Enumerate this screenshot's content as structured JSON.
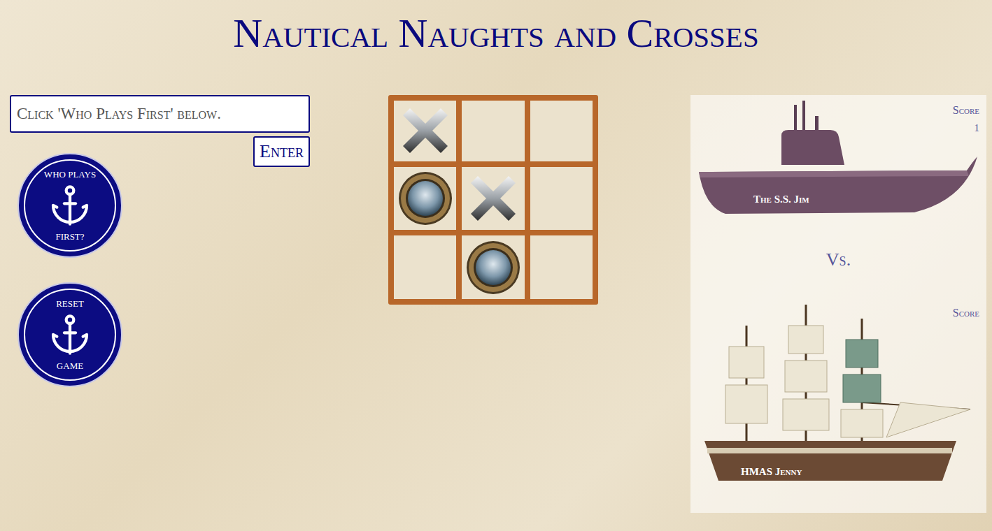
{
  "title": "Nautical Naughts and Crosses",
  "prompt": {
    "text": "Click 'Who Plays First' below."
  },
  "enter_button": "Enter",
  "round_buttons": [
    {
      "top": "WHO PLAYS",
      "bottom": "FIRST?"
    },
    {
      "top": "RESET",
      "bottom": "GAME"
    }
  ],
  "board": {
    "cells": [
      {
        "mark": "cross"
      },
      {
        "mark": "none"
      },
      {
        "mark": "none"
      },
      {
        "mark": "naught"
      },
      {
        "mark": "cross"
      },
      {
        "mark": "none"
      },
      {
        "mark": "none"
      },
      {
        "mark": "naught"
      },
      {
        "mark": "none"
      }
    ]
  },
  "versus": "Vs.",
  "players": [
    {
      "name": "The S.S. Jim",
      "kind": "submarine",
      "score_label": "Score",
      "score": "1"
    },
    {
      "name": "HMAS Jenny",
      "kind": "sailship",
      "score_label": "Score"
    }
  ]
}
